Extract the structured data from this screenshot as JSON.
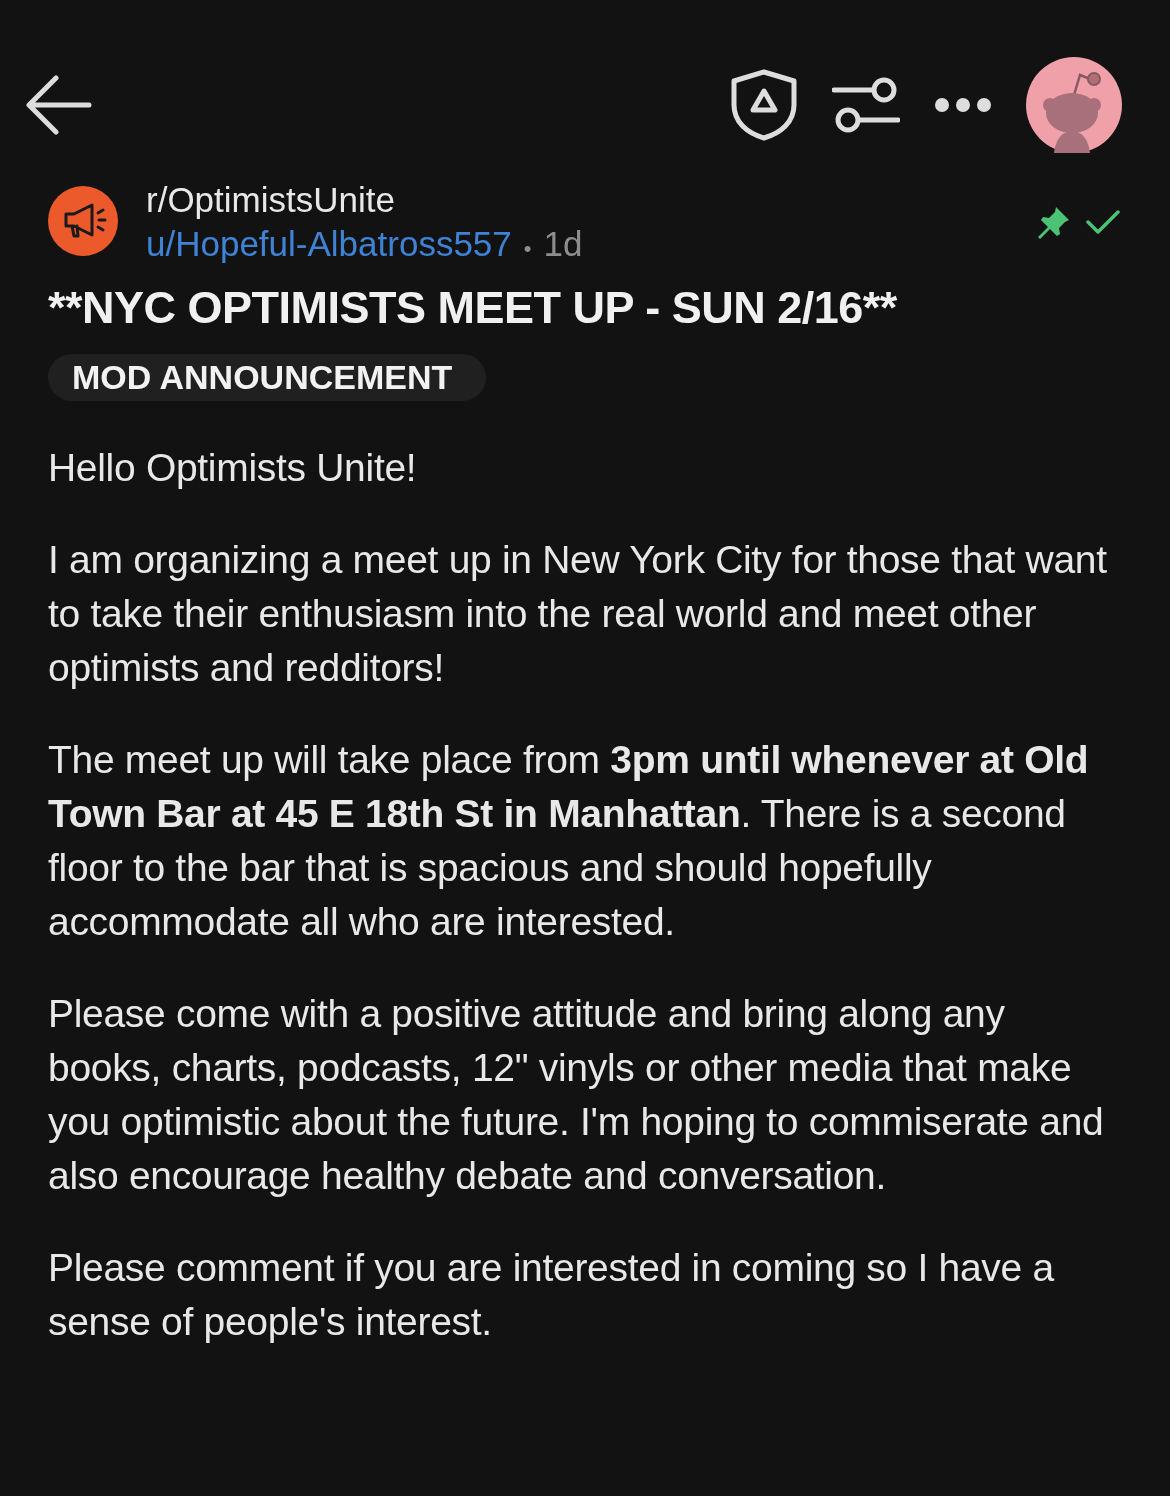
{
  "post": {
    "community": "r/OptimistsUnite",
    "author": "u/Hopeful-Albatross557",
    "separator": "•",
    "age": "1d",
    "pinned": true,
    "approved": true,
    "title": "**NYC OPTIMISTS MEET UP - SUN 2/16**",
    "flair": "MOD ANNOUNCEMENT",
    "paragraphs": [
      "Hello Optimists Unite!",
      "I am organizing a meet up in New York City for those that want to take their enthusiasm into the real world and meet other optimists and redditors!",
      "The meet up will take place from **3pm until whenever at Old Town Bar at 45 E 18th St in Manhattan**. There is a second floor to the bar that is spacious and should hopefully accommodate all who are interested.",
      "Please come with a positive attitude and bring along any books, charts, podcasts, 12\" vinyls or other media that make you optimistic about the future. I'm hoping to commiserate and also encourage healthy debate and conversation.",
      "Please comment if you are interested in coming so I have a sense of people's interest."
    ]
  }
}
